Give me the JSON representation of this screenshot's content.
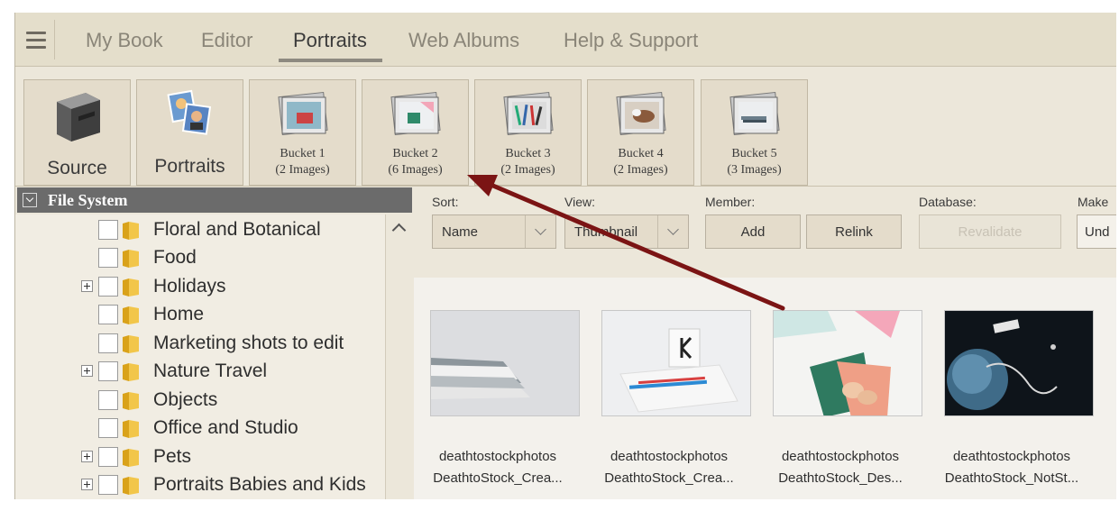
{
  "nav": {
    "tabs": [
      {
        "label": "My Book"
      },
      {
        "label": "Editor"
      },
      {
        "label": "Portraits"
      },
      {
        "label": "Web Albums"
      },
      {
        "label": "Help & Support"
      }
    ],
    "active_tab": "Portraits"
  },
  "toolbar": {
    "source_label": "Source",
    "portraits_label": "Portraits",
    "buckets": [
      {
        "name": "Bucket 1",
        "count": "(2 Images)"
      },
      {
        "name": "Bucket 2",
        "count": "(6 Images)"
      },
      {
        "name": "Bucket 3",
        "count": "(2 Images)"
      },
      {
        "name": "Bucket 4",
        "count": "(2 Images)"
      },
      {
        "name": "Bucket 5",
        "count": "(3 Images)"
      }
    ]
  },
  "sidebar": {
    "header": "File System",
    "folders": [
      {
        "label": "Floral and Botanical",
        "expandable": false
      },
      {
        "label": "Food",
        "expandable": false
      },
      {
        "label": "Holidays",
        "expandable": true
      },
      {
        "label": "Home",
        "expandable": false
      },
      {
        "label": "Marketing shots to edit",
        "expandable": false
      },
      {
        "label": "Nature Travel",
        "expandable": true
      },
      {
        "label": "Objects",
        "expandable": false
      },
      {
        "label": "Office and Studio",
        "expandable": false
      },
      {
        "label": "Pets",
        "expandable": true
      },
      {
        "label": "Portraits Babies and Kids",
        "expandable": true
      }
    ]
  },
  "controls": {
    "sort_label": "Sort:",
    "sort_value": "Name",
    "view_label": "View:",
    "view_value": "Thumbnail",
    "member_label": "Member:",
    "add_label": "Add",
    "relink_label": "Relink",
    "database_label": "Database:",
    "revalidate_label": "Revalidate",
    "make_label": "Make",
    "undo_label": "Und"
  },
  "thumbnails": [
    {
      "line1": "deathtostockphotos",
      "line2": "DeathtoStock_Crea..."
    },
    {
      "line1": "deathtostockphotos",
      "line2": "DeathtoStock_Crea..."
    },
    {
      "line1": "deathtostockphotos",
      "line2": "DeathtoStock_Des..."
    },
    {
      "line1": "deathtostockphotos",
      "line2": "DeathtoStock_NotSt..."
    }
  ],
  "colors": {
    "annotation_arrow": "#7b1414",
    "sidebar_header": "#6b6b6b",
    "panel_bg": "#ece7da"
  }
}
